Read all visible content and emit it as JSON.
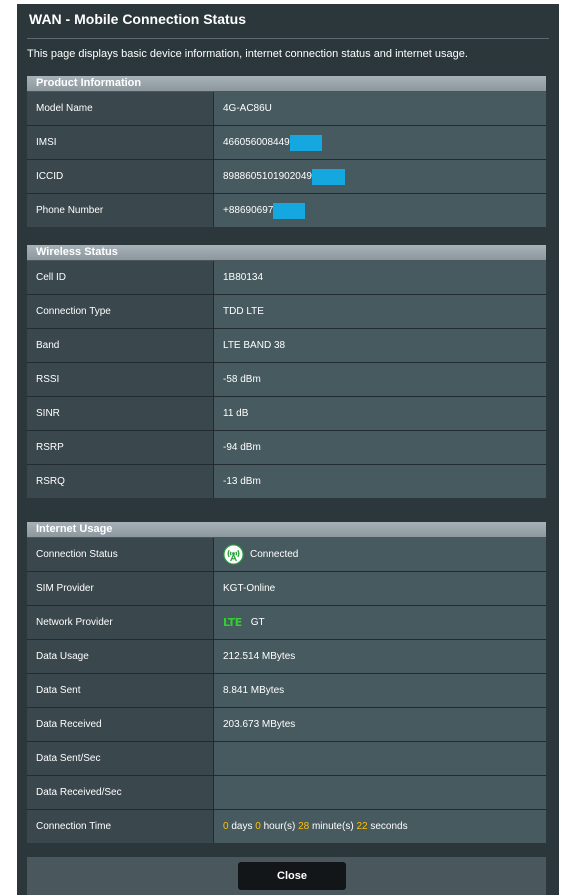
{
  "dialog": {
    "title": "WAN - Mobile Connection Status",
    "description": "This page displays basic device information, internet connection status and internet usage."
  },
  "product_info": {
    "header": "Product Information",
    "rows": [
      {
        "label": "Model Name",
        "value": "4G-AC86U"
      },
      {
        "label": "IMSI",
        "value": "466056008449"
      },
      {
        "label": "ICCID",
        "value": "8988605101902049"
      },
      {
        "label": "Phone Number",
        "value": "+88690697"
      }
    ]
  },
  "wireless_status": {
    "header": "Wireless Status",
    "rows": [
      {
        "label": "Cell ID",
        "value": "1B80134"
      },
      {
        "label": "Connection Type",
        "value": "TDD LTE"
      },
      {
        "label": "Band",
        "value": "LTE BAND 38"
      },
      {
        "label": "RSSI",
        "value": "-58 dBm"
      },
      {
        "label": "SINR",
        "value": "11 dB"
      },
      {
        "label": "RSRP",
        "value": "-94 dBm"
      },
      {
        "label": "RSRQ",
        "value": "-13 dBm"
      }
    ]
  },
  "internet_usage": {
    "header": "Internet Usage",
    "rows": [
      {
        "label": "Connection Status",
        "value": "Connected",
        "icon": "signal-connected-icon"
      },
      {
        "label": "SIM Provider",
        "value": "KGT-Online"
      },
      {
        "label": "Network Provider",
        "value": "GT",
        "badge": "LTE"
      },
      {
        "label": "Data Usage",
        "value": "212.514 MBytes"
      },
      {
        "label": "Data Sent",
        "value": "8.841 MBytes"
      },
      {
        "label": "Data Received",
        "value": "203.673 MBytes"
      },
      {
        "label": "Data Sent/Sec",
        "value": ""
      },
      {
        "label": "Data Received/Sec",
        "value": ""
      },
      {
        "label": "Connection Time"
      }
    ],
    "connection_time": {
      "days": "0",
      "days_unit": "days",
      "hours": "0",
      "hours_unit": "hour(s)",
      "minutes": "28",
      "minutes_unit": "minute(s)",
      "seconds": "22",
      "seconds_unit": "seconds"
    }
  },
  "footer": {
    "close_label": "Close"
  },
  "colors": {
    "dialog_bg": "#2b373b",
    "highlight": "#ffc000",
    "lte_green": "#2ed12e",
    "mask_blue": "#15a8e0"
  }
}
